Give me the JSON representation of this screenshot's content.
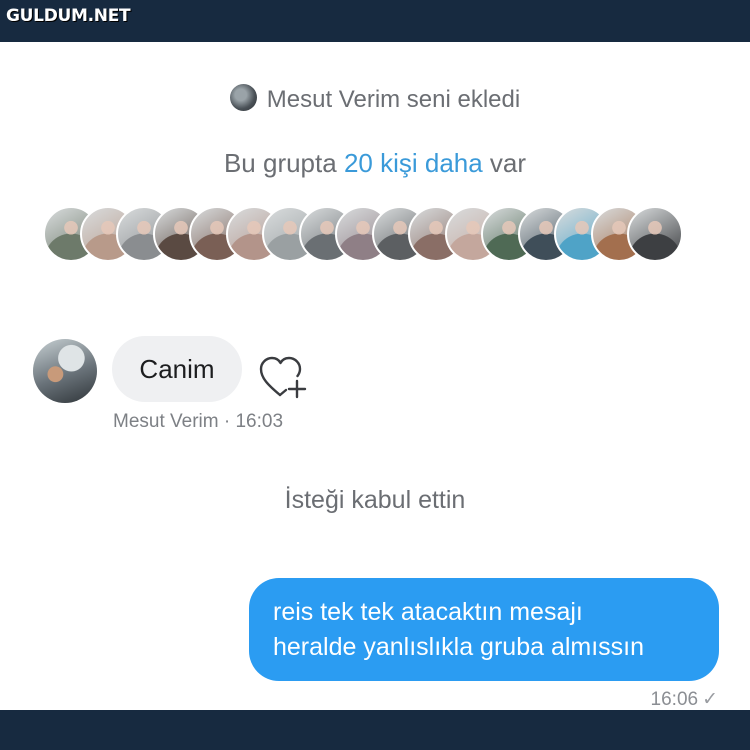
{
  "watermark": "GULDUM.NET",
  "chat": {
    "added_notice": "Mesut Verim seni ekledi",
    "members_prefix": "Bu grupta ",
    "members_link": "20 kişi daha",
    "members_suffix": " var",
    "member_avatar_colors": [
      "#6d7a6a",
      "#b89a8a",
      "#8a8d90",
      "#5a4a42",
      "#7a5f55",
      "#b3948a",
      "#9aa0a2",
      "#6a6f73",
      "#8f7f86",
      "#5c5f62",
      "#8a6e66",
      "#c4a79d",
      "#4f6a55",
      "#3f4e59",
      "#4fa3c7",
      "#a36f4e",
      "#3d3f42"
    ],
    "incoming": {
      "text": "Canim",
      "sender": "Mesut Verim",
      "time": "· 16:03"
    },
    "system_notice": "İsteği kabul ettin",
    "outgoing": {
      "line1": "reis tek tek atacaktın mesajı",
      "line2": "heralde yanlıslıkla gruba almıssın",
      "time": "16:06",
      "status": "✓"
    }
  },
  "colors": {
    "bar": "#172a40",
    "link": "#3a9ad9",
    "outgoing_bubble": "#2b9cf2",
    "incoming_bubble": "#eff0f2"
  }
}
